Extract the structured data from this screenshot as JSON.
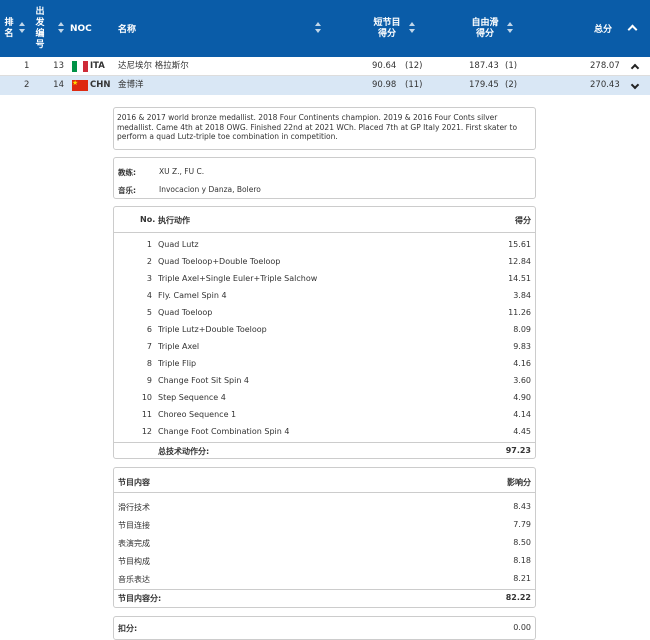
{
  "header": {
    "rank": [
      "排",
      "名"
    ],
    "start_no": [
      "出",
      "发",
      "编",
      "号"
    ],
    "noc": "NOC",
    "name": "名称",
    "sp": [
      "短节目",
      "得分"
    ],
    "fs": [
      "自由滑",
      "得分"
    ],
    "total": "总分"
  },
  "rows": [
    {
      "rank": "1",
      "start": "13",
      "noc": "ITA",
      "name": "达尼埃尔 格拉斯尔",
      "sp": "90.64",
      "sp_rank": "(12)",
      "fs": "187.43",
      "fs_rank": "(1)",
      "total": "278.07"
    },
    {
      "rank": "2",
      "start": "14",
      "noc": "CHN",
      "name": "金博洋",
      "sp": "90.98",
      "sp_rank": "(11)",
      "fs": "179.45",
      "fs_rank": "(2)",
      "total": "270.43"
    }
  ],
  "bio": "2016 & 2017 world bronze medallist. 2018 Four Continents champion. 2019 & 2016 Four Conts silver medallist. Came 4th at 2018 OWG. Finished 22nd at 2021 WCh. Placed 7th at GP Italy 2021. First skater to perform a quad Lutz-triple toe combination in competition.",
  "staff": {
    "coach_label": "教练:",
    "coach": "XU Z., FU C.",
    "music_label": "音乐:",
    "music": "Invocacion y Danza, Bolero"
  },
  "elements": {
    "h_no": "No.",
    "h_elem": "执行动作",
    "h_score": "得分",
    "items": [
      {
        "no": "1",
        "name": "Quad Lutz",
        "score": "15.61"
      },
      {
        "no": "2",
        "name": "Quad Toeloop+Double Toeloop",
        "score": "12.84"
      },
      {
        "no": "3",
        "name": "Triple Axel+Single Euler+Triple Salchow",
        "score": "14.51"
      },
      {
        "no": "4",
        "name": "Fly. Camel Spin 4",
        "score": "3.84"
      },
      {
        "no": "5",
        "name": "Quad Toeloop",
        "score": "11.26"
      },
      {
        "no": "6",
        "name": "Triple Lutz+Double Toeloop",
        "score": "8.09"
      },
      {
        "no": "7",
        "name": "Triple Axel",
        "score": "9.83"
      },
      {
        "no": "8",
        "name": "Triple Flip",
        "score": "4.16"
      },
      {
        "no": "9",
        "name": "Change Foot Sit Spin 4",
        "score": "3.60"
      },
      {
        "no": "10",
        "name": "Step Sequence 4",
        "score": "4.90"
      },
      {
        "no": "11",
        "name": "Choreo Sequence 1",
        "score": "4.14"
      },
      {
        "no": "12",
        "name": "Change Foot Combination Spin 4",
        "score": "4.45"
      }
    ],
    "total_label": "总技术动作分:",
    "total": "97.23"
  },
  "components": {
    "h_label": "节目内容",
    "h_score": "影响分",
    "items": [
      {
        "name": "滑行技术",
        "score": "8.43"
      },
      {
        "name": "节目连接",
        "score": "7.79"
      },
      {
        "name": "表演完成",
        "score": "8.50"
      },
      {
        "name": "节目构成",
        "score": "8.18"
      },
      {
        "name": "音乐表达",
        "score": "8.21"
      }
    ],
    "total_label": "节目内容分:",
    "total": "82.22"
  },
  "deductions": {
    "label": "扣分:",
    "value": "0.00"
  },
  "colors": {
    "header_bg": "#0a5ca8",
    "selected_row": "#d9e7f5",
    "ita": [
      "#009246",
      "#ffffff",
      "#ce2b37"
    ],
    "chn": "#de2910"
  }
}
